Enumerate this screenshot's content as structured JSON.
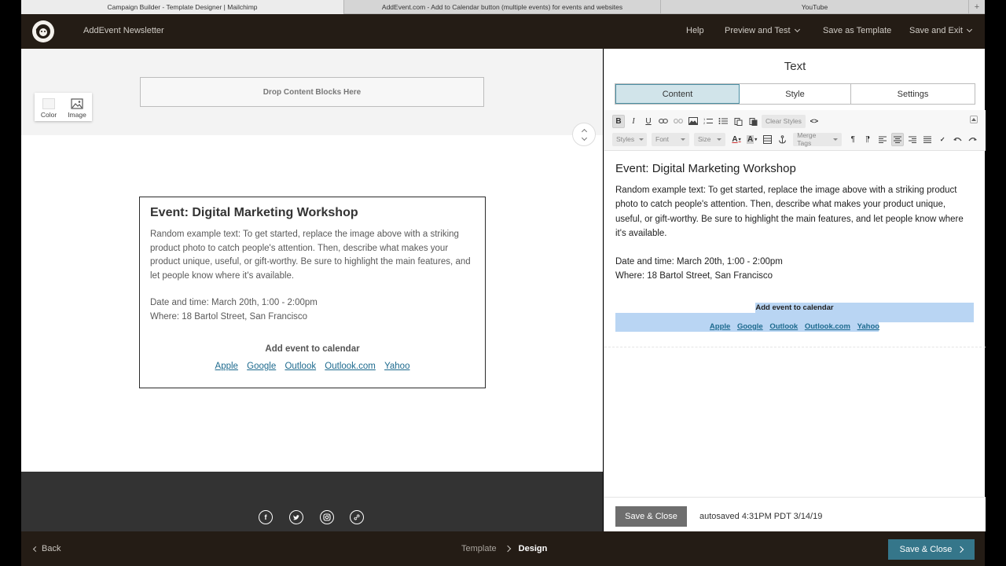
{
  "browser": {
    "tabs": [
      {
        "label": "Campaign Builder - Template Designer | Mailchimp",
        "active": true
      },
      {
        "label": "AddEvent.com - Add to Calendar button (multiple events) for events and websites",
        "active": false
      },
      {
        "label": "YouTube",
        "active": false
      }
    ],
    "new_tab": "+"
  },
  "header": {
    "title": "AddEvent Newsletter",
    "nav": {
      "help": "Help",
      "preview": "Preview and Test",
      "save_template": "Save as Template",
      "save_exit": "Save and Exit"
    }
  },
  "canvas": {
    "drop_zone": "Drop Content Blocks Here",
    "bg_tools": {
      "color": "Color",
      "image": "Image"
    },
    "event": {
      "title": "Event: Digital Marketing Workshop",
      "description": "Random example text: To get started, replace the image above with a striking product photo to catch people's attention. Then, describe what makes your product unique, useful, or gift-worthy. Be sure to highlight the main features, and let people know where it's available.",
      "datetime": "Date and time: March 20th, 1:00 - 2:00pm",
      "where": "Where: 18 Bartol Street, San Francisco",
      "calendar_heading": "Add event to calendar",
      "links": [
        "Apple",
        "Google",
        "Outlook",
        "Outlook.com",
        "Yahoo"
      ]
    },
    "social_icons": [
      "facebook-icon",
      "twitter-icon",
      "instagram-icon",
      "link-icon"
    ]
  },
  "panel": {
    "title": "Text",
    "tabs": [
      {
        "label": "Content",
        "active": true
      },
      {
        "label": "Style",
        "active": false
      },
      {
        "label": "Settings",
        "active": false
      }
    ],
    "toolbar": {
      "bold": "B",
      "italic": "I",
      "underline": "U",
      "clear_styles": "Clear Styles",
      "source": "<>",
      "styles": "Styles",
      "font": "Font",
      "size": "Size",
      "text_color": "A",
      "bg_color": "A",
      "merge_tags": "Merge Tags"
    },
    "editor": {
      "title": "Event: Digital Marketing Workshop",
      "description": "Random example text: To get started, replace the image above with a striking product photo to catch people's attention. Then, describe what makes your product unique, useful, or gift-worthy. Be sure to highlight the main features, and let people know where it's available.",
      "datetime": "Date and time: March 20th, 1:00 - 2:00pm",
      "where": "Where: 18 Bartol Street, San Francisco",
      "calendar_heading": "Add event to calendar",
      "links": [
        "Apple",
        "Google",
        "Outlook",
        "Outlook.com",
        "Yahoo"
      ]
    },
    "footer": {
      "save_close": "Save & Close",
      "autosave": "autosaved 4:31PM PDT 3/14/19"
    }
  },
  "bottom": {
    "back": "Back",
    "crumbs": {
      "template": "Template",
      "design": "Design"
    },
    "save_close": "Save & Close"
  },
  "colors": {
    "header_bg": "#241c15",
    "accent": "#35768a",
    "link": "#1d6a8e",
    "selection": "#b9d5f3",
    "active_tab": "#d1e4ea"
  }
}
